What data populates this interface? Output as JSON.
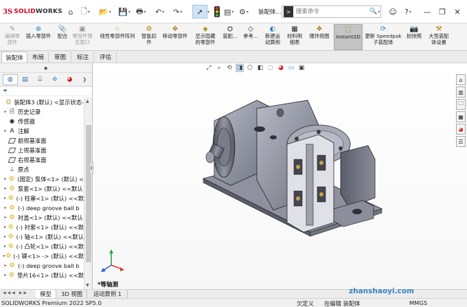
{
  "titlebar": {
    "brand_ds": "3S",
    "brand_solid": "SOLID",
    "brand_works": "WORKS",
    "doc_name": "装配体...",
    "search_placeholder": "搜索命令",
    "icons": [
      "home-icon",
      "new-doc-icon",
      "open-icon",
      "save-icon",
      "print-icon",
      "undo-icon",
      "redo-icon",
      "select-pointer-icon",
      "rebuild-icon",
      "file-props-icon",
      "options-icon"
    ]
  },
  "commands": [
    {
      "label": "编辑零\n部件",
      "icon": "edit-component-icon",
      "disabled": true
    },
    {
      "label": "插入零部件",
      "icon": "insert-component-icon",
      "disabled": false
    },
    {
      "label": "配合",
      "icon": "mate-icon",
      "disabled": false
    },
    {
      "label": "零部件预\n览窗口",
      "icon": "preview-window-icon",
      "disabled": true
    },
    {
      "label": "线性零部件阵列",
      "icon": "linear-pattern-icon",
      "disabled": false
    },
    {
      "label": "智能扣\n件",
      "icon": "smart-fastener-icon",
      "disabled": false
    },
    {
      "label": "移动零部件",
      "icon": "move-component-icon",
      "disabled": false
    },
    {
      "label": "显示隐藏\n的零部件",
      "icon": "show-hidden-icon",
      "disabled": false
    },
    {
      "label": "装配...",
      "icon": "assembly-feature-icon",
      "disabled": false
    },
    {
      "label": "参考...",
      "icon": "reference-geometry-icon",
      "disabled": false
    },
    {
      "label": "新建运\n动算例",
      "icon": "motion-study-icon",
      "disabled": false
    },
    {
      "label": "材料明\n细表",
      "icon": "bom-icon",
      "disabled": false
    },
    {
      "label": "爆炸视图",
      "icon": "exploded-view-icon",
      "disabled": false
    },
    {
      "label": "Instant3D",
      "icon": "instant3d-icon",
      "disabled": false,
      "active": true
    },
    {
      "label": "更新 Speedpak\n子装配体",
      "icon": "speedpak-icon",
      "disabled": false
    },
    {
      "label": "拍快照",
      "icon": "snapshot-icon",
      "disabled": false
    },
    {
      "label": "大型装配\n体设置",
      "icon": "large-assembly-icon",
      "disabled": false
    }
  ],
  "tabs": [
    "装配体",
    "布局",
    "草图",
    "标注",
    "评估"
  ],
  "tree": [
    {
      "label": "装配体3 (默认) <显示状态-",
      "icon": "assembly-icon",
      "expander": "",
      "indent": 0
    },
    {
      "label": "历史记录",
      "icon": "history-icon",
      "expander": "▸",
      "indent": 1
    },
    {
      "label": "传感器",
      "icon": "sensor-icon",
      "expander": "",
      "indent": 1
    },
    {
      "label": "注解",
      "icon": "annotation-icon",
      "expander": "▸",
      "indent": 1
    },
    {
      "label": "前视基准面",
      "icon": "plane-icon",
      "expander": "",
      "indent": 1
    },
    {
      "label": "上视基准面",
      "icon": "plane-icon",
      "expander": "",
      "indent": 1
    },
    {
      "label": "右视基准面",
      "icon": "plane-icon",
      "expander": "",
      "indent": 1
    },
    {
      "label": "原点",
      "icon": "origin-icon",
      "expander": "",
      "indent": 1
    },
    {
      "label": "(固定) 泵体<1> (默认) <",
      "icon": "part-icon",
      "expander": "▸",
      "indent": 1
    },
    {
      "label": "泵套<1> (默认) <<默认",
      "icon": "part-icon",
      "expander": "▸",
      "indent": 1
    },
    {
      "label": "(-) 柱塞<1> (默认) <<默",
      "icon": "part-icon",
      "expander": "▸",
      "indent": 1
    },
    {
      "label": "(-) deep groove ball b",
      "icon": "part-icon",
      "expander": "▸",
      "indent": 1
    },
    {
      "label": "衬盖<1> (默认) <<默认",
      "icon": "part-icon",
      "expander": "▸",
      "indent": 1
    },
    {
      "label": "(-) 衬套<1> (默认) <<默",
      "icon": "part-icon",
      "expander": "▸",
      "indent": 1
    },
    {
      "label": "(-) 轴<1> (默认) <<默认",
      "icon": "part-icon",
      "expander": "▸",
      "indent": 1
    },
    {
      "label": "(-) 凸轮<1> (默认) <<默",
      "icon": "part-icon",
      "expander": "▸",
      "indent": 1
    },
    {
      "label": "(-) 键<1> -> (默认) <<默",
      "icon": "part-icon",
      "expander": "▸",
      "indent": 1
    },
    {
      "label": "(-) deep groove ball b",
      "icon": "part-icon",
      "expander": "▸",
      "indent": 1
    },
    {
      "label": "垫片16<1> (默认) <<默",
      "icon": "part-icon",
      "expander": "▸",
      "indent": 1
    }
  ],
  "graphics": {
    "view_name": "*等轴测",
    "heads_up_icons": [
      "zoom-fit-icon",
      "zoom-area-icon",
      "previous-view-icon",
      "section-view-icon",
      "view-orientation-icon",
      "display-style-icon",
      "hide-show-icon",
      "edit-appearance-icon",
      "scene-icon",
      "view-settings-icon"
    ],
    "task_pane_icons": [
      "home-pane-icon",
      "design-library-icon",
      "file-explorer-icon",
      "view-palette-icon",
      "appearances-icon",
      "custom-props-icon"
    ]
  },
  "bottom_tabs": [
    "模型",
    "3D 视图",
    "运动算例 1"
  ],
  "status": {
    "product": "SOLIDWORKS Premium 2022 SP5.0",
    "constraint": "欠定义",
    "mode": "在编辑 装配体",
    "units": "MMGS"
  },
  "watermark": "zhanshaoyi.com"
}
